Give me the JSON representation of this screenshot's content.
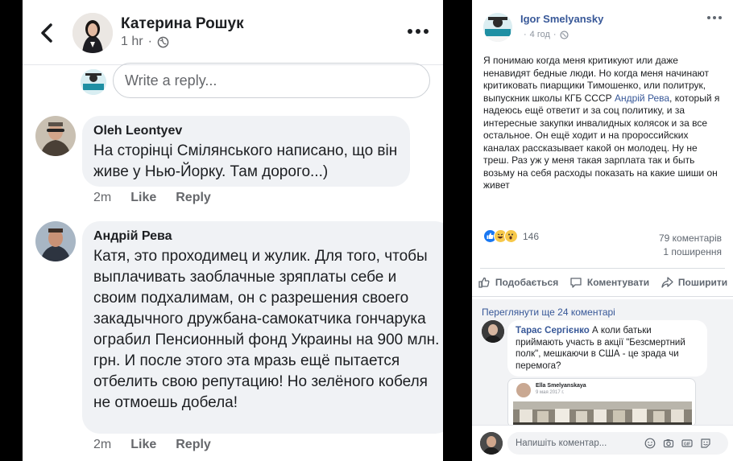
{
  "mobile": {
    "header": {
      "name": "Катерина Рошук",
      "time": "1 hr"
    },
    "reply": {
      "placeholder": "Write a reply..."
    },
    "comments": [
      {
        "author": "Oleh Leontyev",
        "text": "На сторінці Смілянського написано, що він живе у Нью-Йорку. Там дорого...)",
        "time": "2m",
        "like": "Like",
        "reply": "Reply"
      },
      {
        "author": "Андрій Рева",
        "text": "Катя, это проходимец и жулик. Для того, чтобы выплачивать заоблачные зряплаты себе и своим подхалимам, он с разрешения своего закадычного дружбана-самокатчика гончарука ограбил Пенсионный фонд Украины на 900 млн. грн. И после этого эта мразь ещё пытается отбелить свою репутацию! Но зелёного кобеля не отмоешь добела!",
        "time": "2m",
        "like": "Like",
        "reply": "Reply"
      }
    ]
  },
  "desktop": {
    "author": "Igor Smelyansky",
    "time": "4 год",
    "post_text_before": "Я понимаю когда меня критикуют или даже ненавидят бедные люди. Но когда меня начинают критиковать пиарщики Тимошенко, или политрук, выпускник школы КГБ СССР ",
    "post_link": "Андрій Рева",
    "post_text_after": ", который я надеюсь ещё ответит и за соц политику, и за интересные закупки инвалидных колясок и за все остальное. Он ещё ходит и на пророссийских каналах рассказывает какой он молодец. Ну не треш. Раз уж у меня такая зарплата так и быть возьму на себя расходы показать на какие шиши он живет",
    "reactions_count": "146",
    "comments_count": "79 коментарів",
    "shares_count": "1 поширення",
    "actions": {
      "like": "Подобається",
      "comment": "Коментувати",
      "share": "Поширити"
    },
    "more_comments": "Переглянути ще 24 коментарі",
    "comment": {
      "author": "Тарас Сергієнко",
      "text": " А коли батьки приймають участь в акції \"Безсмертний полк\", мешкаючи в США - це зрада чи перемога?"
    },
    "attachment": {
      "name": "Ella Smelyanskaya",
      "date": "9 мая 2017 г."
    },
    "input_placeholder": "Напишіть коментар...",
    "colors": {
      "link": "#385898",
      "like_blue": "#1877f2",
      "bubble_bg": "#f0f2f5"
    }
  }
}
